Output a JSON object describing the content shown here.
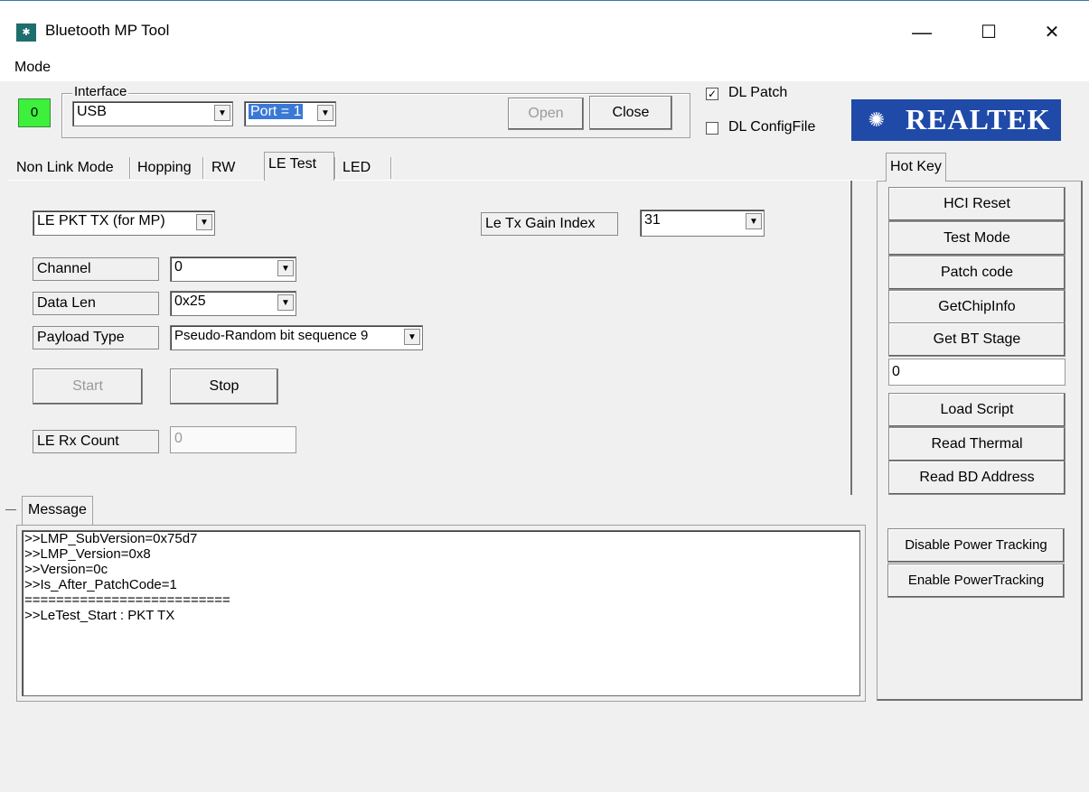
{
  "window": {
    "title": "Bluetooth MP Tool",
    "icon": "app-icon",
    "controls": {
      "minimize": "—",
      "maximize": "☐",
      "close": "✕"
    }
  },
  "menu": {
    "items": [
      "Mode"
    ]
  },
  "top": {
    "status_value": "0",
    "status_color": "#3cf03c",
    "interface_label": "Interface",
    "interface_value": "USB",
    "port_value": "Port = 1",
    "open_label": "Open",
    "close_label": "Close",
    "dl_patch_label": "DL Patch",
    "dl_patch_checked": true,
    "dl_config_label": "DL ConfigFile",
    "dl_config_checked": false,
    "logo_text": "REALTEK",
    "logo_color": "#1f4aa8"
  },
  "tabs": [
    {
      "label": "Non Link Mode"
    },
    {
      "label": "Hopping"
    },
    {
      "label": "RW"
    },
    {
      "label": "LE Test",
      "active": true
    },
    {
      "label": "LED"
    }
  ],
  "le_test": {
    "mode_value": "LE PKT TX (for MP)",
    "gain_label": "Le Tx Gain Index",
    "gain_value": "31",
    "channel_label": "Channel",
    "channel_value": "0",
    "datalen_label": "Data Len",
    "datalen_value": "0x25",
    "payload_label": "Payload Type",
    "payload_value": "Pseudo-Random bit sequence 9",
    "start_label": "Start",
    "stop_label": "Stop",
    "rx_count_label": "LE Rx Count",
    "rx_count_value": "0"
  },
  "message": {
    "tab_label": "Message",
    "lines": [
      ">>LMP_SubVersion=0x75d7",
      ">>LMP_Version=0x8",
      ">>Version=0c",
      ">>Is_After_PatchCode=1",
      "==========================",
      "",
      ">>LeTest_Start : PKT TX"
    ]
  },
  "hotkey": {
    "tab_label": "Hot Key",
    "buttons1": [
      "HCI Reset",
      "Test Mode",
      "Patch code",
      "GetChipInfo",
      "Get BT Stage"
    ],
    "input_value": "0",
    "buttons2": [
      "Load Script",
      "Read Thermal",
      "Read BD Address"
    ],
    "buttons3": [
      "Disable Power Tracking",
      "Enable PowerTracking"
    ]
  }
}
